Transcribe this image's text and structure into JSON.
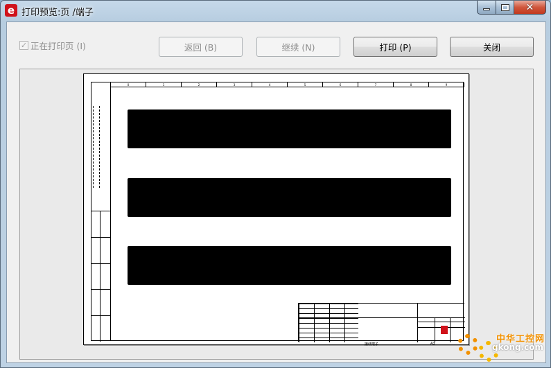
{
  "window": {
    "title": "打印预览:页 /端子",
    "app_icon_glyph": "e",
    "caption": {
      "minimize": "minimize-icon",
      "maximize": "maximize-icon",
      "close_glyph": "✕"
    }
  },
  "toolbar": {
    "checkbox_label": "正在打印页 (I)",
    "checkbox_checked": true,
    "check_glyph": "✓",
    "back_label": "返回 (B)",
    "continue_label": "继续 (N)",
    "print_label": "打印 (P)",
    "close_label": "关闭"
  },
  "preview": {
    "ruler": [
      "0",
      "1",
      "2",
      "3",
      "4",
      "5",
      "6",
      "7",
      "8",
      "9"
    ],
    "footer_left": "接线端子",
    "footer_right": "A3"
  },
  "watermark": {
    "cn": "中华工控网",
    "url": "gkong.com"
  },
  "colors": {
    "app_icon": "#d0121b",
    "watermark": "#f29100"
  }
}
